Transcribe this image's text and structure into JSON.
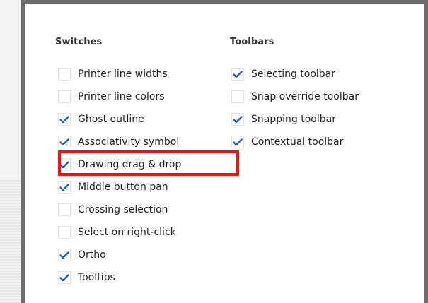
{
  "switches": {
    "title": "Switches",
    "items": [
      {
        "label": "Printer line widths",
        "checked": false
      },
      {
        "label": "Printer line colors",
        "checked": false
      },
      {
        "label": "Ghost outline",
        "checked": true
      },
      {
        "label": "Associativity symbol",
        "checked": true
      },
      {
        "label": "Drawing drag & drop",
        "checked": true
      },
      {
        "label": "Middle button pan",
        "checked": true
      },
      {
        "label": "Crossing selection",
        "checked": false
      },
      {
        "label": "Select on right-click",
        "checked": false
      },
      {
        "label": "Ortho",
        "checked": true
      },
      {
        "label": "Tooltips",
        "checked": true
      }
    ]
  },
  "toolbars": {
    "title": "Toolbars",
    "items": [
      {
        "label": "Selecting toolbar",
        "checked": true
      },
      {
        "label": "Snap override toolbar",
        "checked": false
      },
      {
        "label": "Snapping toolbar",
        "checked": true
      },
      {
        "label": "Contextual toolbar",
        "checked": true
      }
    ]
  },
  "colors": {
    "check": "#1f5fb4",
    "highlight": "#ee1111",
    "panel_border": "#6d6d6d"
  },
  "icons": {
    "check": "checkmark-icon"
  },
  "highlighted_item": "Drawing drag & drop"
}
